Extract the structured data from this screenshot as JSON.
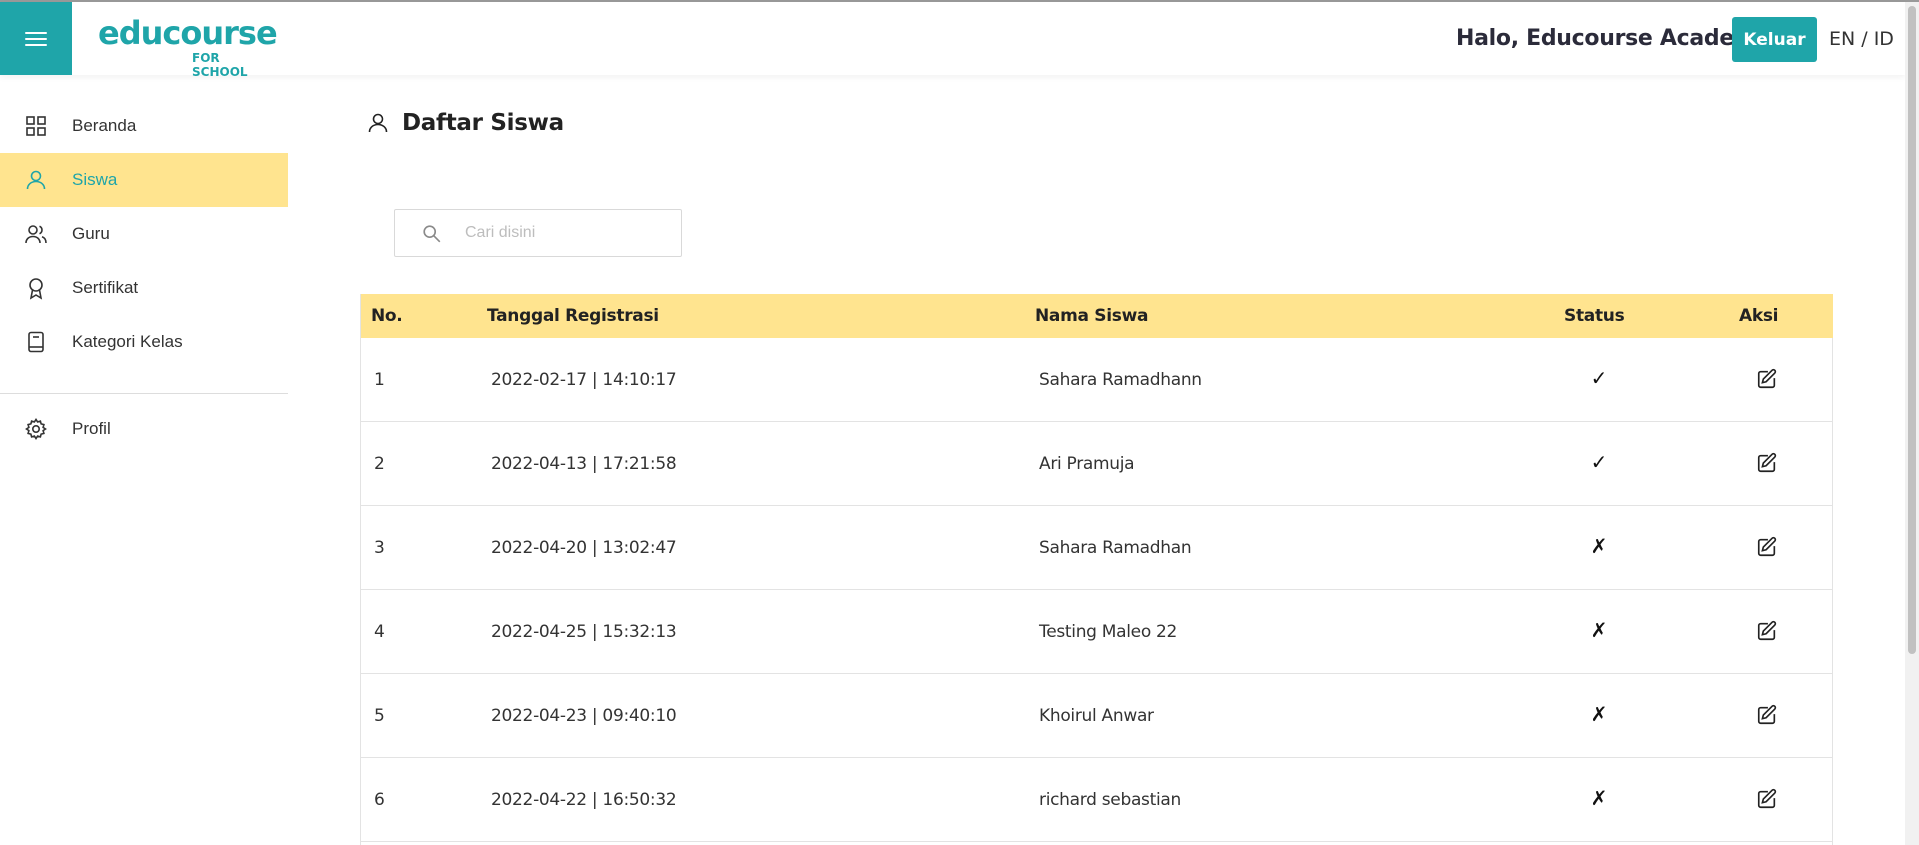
{
  "header": {
    "logo_text": "educourse",
    "logo_sub": "FOR SCHOOL",
    "greeting": "Halo, Educourse Academy",
    "logout_label": "Keluar",
    "language": "EN / ID"
  },
  "sidebar": {
    "items": [
      {
        "label": "Beranda",
        "icon": "grid-icon",
        "active": false
      },
      {
        "label": "Siswa",
        "icon": "user-icon",
        "active": true
      },
      {
        "label": "Guru",
        "icon": "users-icon",
        "active": false
      },
      {
        "label": "Sertifikat",
        "icon": "award-icon",
        "active": false
      },
      {
        "label": "Kategori Kelas",
        "icon": "book-icon",
        "active": false
      },
      {
        "label": "Profil",
        "icon": "gear-icon",
        "active": false
      }
    ]
  },
  "main": {
    "title": "Daftar Siswa",
    "search_placeholder": "Cari disini",
    "table": {
      "headers": [
        "No.",
        "Tanggal Registrasi",
        "Nama Siswa",
        "Status",
        "Aksi"
      ],
      "rows": [
        {
          "no": "1",
          "date": "2022-02-17 | 14:10:17",
          "name": "Sahara Ramadhann",
          "status": "✓"
        },
        {
          "no": "2",
          "date": "2022-04-13 | 17:21:58",
          "name": "Ari Pramuja",
          "status": "✓"
        },
        {
          "no": "3",
          "date": "2022-04-20 | 13:02:47",
          "name": "Sahara Ramadhan",
          "status": "✗"
        },
        {
          "no": "4",
          "date": "2022-04-25 | 15:32:13",
          "name": "Testing Maleo 22",
          "status": "✗"
        },
        {
          "no": "5",
          "date": "2022-04-23 | 09:40:10",
          "name": "Khoirul Anwar",
          "status": "✗"
        },
        {
          "no": "6",
          "date": "2022-04-22 | 16:50:32",
          "name": "richard sebastian",
          "status": "✗"
        }
      ]
    }
  },
  "colors": {
    "primary": "#1fa5a9",
    "highlight": "#ffe48f"
  }
}
